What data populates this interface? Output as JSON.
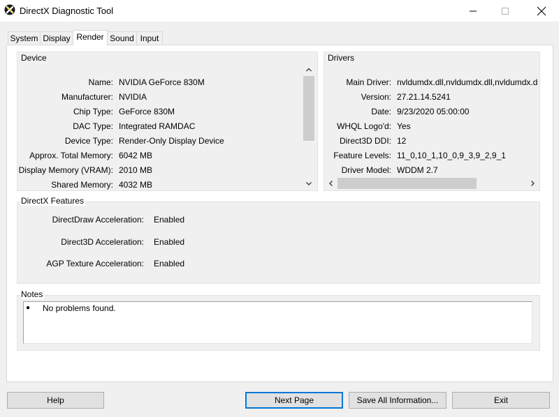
{
  "window": {
    "title": "DirectX Diagnostic Tool"
  },
  "tabs": [
    {
      "label": "System",
      "active": false
    },
    {
      "label": "Display",
      "active": false
    },
    {
      "label": "Render",
      "active": true
    },
    {
      "label": "Sound",
      "active": false
    },
    {
      "label": "Input",
      "active": false
    }
  ],
  "device": {
    "title": "Device",
    "rows": [
      {
        "label": "Name:",
        "value": "NVIDIA GeForce 830M"
      },
      {
        "label": "Manufacturer:",
        "value": "NVIDIA"
      },
      {
        "label": "Chip Type:",
        "value": "GeForce 830M"
      },
      {
        "label": "DAC Type:",
        "value": "Integrated RAMDAC"
      },
      {
        "label": "Device Type:",
        "value": "Render-Only Display Device"
      },
      {
        "label": "Approx. Total Memory:",
        "value": "6042 MB"
      },
      {
        "label": "Display Memory (VRAM):",
        "value": "2010 MB"
      },
      {
        "label": "Shared Memory:",
        "value": "4032 MB"
      }
    ]
  },
  "drivers": {
    "title": "Drivers",
    "rows": [
      {
        "label": "Main Driver:",
        "value": "nvldumdx.dll,nvldumdx.dll,nvldumdx.d"
      },
      {
        "label": "Version:",
        "value": "27.21.14.5241"
      },
      {
        "label": "Date:",
        "value": "9/23/2020 05:00:00"
      },
      {
        "label": "WHQL Logo'd:",
        "value": "Yes"
      },
      {
        "label": "Direct3D DDI:",
        "value": "12"
      },
      {
        "label": "Feature Levels:",
        "value": "11_0,10_1,10_0,9_3,9_2,9_1"
      },
      {
        "label": "Driver Model:",
        "value": "WDDM 2.7"
      }
    ]
  },
  "features": {
    "title": "DirectX Features",
    "rows": [
      {
        "label": "DirectDraw Acceleration:",
        "value": "Enabled"
      },
      {
        "label": "Direct3D Acceleration:",
        "value": "Enabled"
      },
      {
        "label": "AGP Texture Acceleration:",
        "value": "Enabled"
      }
    ]
  },
  "notes": {
    "title": "Notes",
    "items": [
      "No problems found."
    ]
  },
  "buttons": {
    "help": "Help",
    "next_page": "Next Page",
    "save_all": "Save All Information...",
    "exit": "Exit"
  }
}
